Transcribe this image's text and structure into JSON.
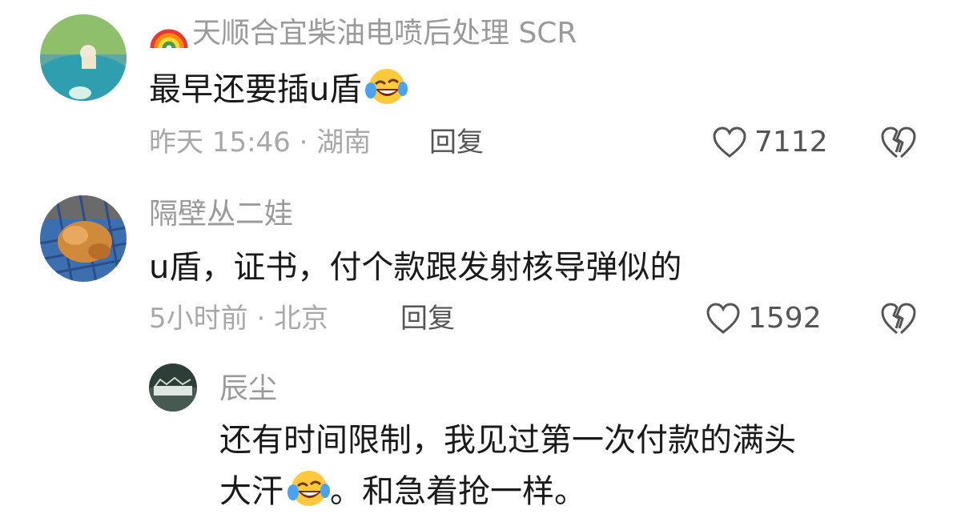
{
  "comments": [
    {
      "username": "天顺合宜柴油电喷后处理 SCR",
      "text": "最早还要插u盾",
      "time": "昨天 15:46 · 湖南",
      "reply_label": "回复",
      "likes": "7112"
    },
    {
      "username": "隔壁丛二娃",
      "text": "u盾，证书，付个款跟发射核导弹似的",
      "time": "5小时前 · 北京",
      "reply_label": "回复",
      "likes": "1592"
    }
  ],
  "reply": {
    "username": "辰尘",
    "text_line1": "还有时间限制，我见过第一次付款的满头",
    "text_line2_a": "大汗",
    "text_line2_b": "。和急着抢一样。"
  },
  "icons": {
    "like": "heart-outline-icon",
    "dislike": "broken-heart-icon",
    "emoji": "laughing-tears-emoji-icon",
    "badge": "rainbow-icon"
  },
  "colors": {
    "username": "#9a9a9a",
    "text": "#1a1a1a",
    "meta": "#a8a8a8",
    "action": "#555555"
  }
}
